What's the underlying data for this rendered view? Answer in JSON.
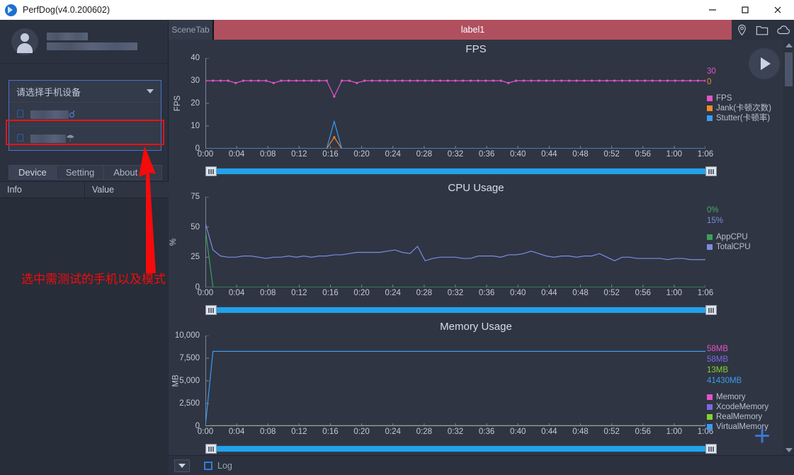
{
  "titlebar": {
    "app_title": "PerfDog(v4.0.200602)",
    "minimize_label": "—",
    "maximize_label": "□",
    "close_label": "✕"
  },
  "sidebar": {
    "device_select": {
      "placeholder": "请选择手机设备",
      "options": [
        {
          "platform_icon": "apple-icon",
          "name_masked": "",
          "connection": "usb-icon"
        },
        {
          "platform_icon": "apple-icon",
          "name_masked": "",
          "connection": "wifi-icon"
        }
      ]
    },
    "tabs": [
      {
        "label": "Device",
        "active": true
      },
      {
        "label": "Setting",
        "active": false
      },
      {
        "label": "About",
        "active": false
      }
    ],
    "table": {
      "columns": [
        "Info",
        "Value"
      ],
      "rows": []
    },
    "annotation": "选中需测试的手机以及模式",
    "annotation_color": "#f50b0b",
    "highlight_box_color": "#ee1111"
  },
  "scenebar": {
    "scene_tab_label": "SceneTab",
    "label_text": "label1",
    "label_color": "#b0505f",
    "icons": [
      "location-pin-icon",
      "folder-icon",
      "cloud-icon"
    ]
  },
  "statusbar": {
    "log_label": "Log",
    "log_checked": false
  },
  "controls": {
    "play_label": "play-icon",
    "add_label": "+"
  },
  "chart_data": [
    {
      "type": "line",
      "title": "FPS",
      "xlabel": "",
      "ylabel": "FPS",
      "ylim": [
        0,
        40
      ],
      "yticks": [
        0,
        10,
        20,
        30,
        40
      ],
      "xticks": [
        "0:00",
        "0:04",
        "0:08",
        "0:12",
        "0:16",
        "0:20",
        "0:24",
        "0:28",
        "0:32",
        "0:36",
        "0:40",
        "0:44",
        "0:48",
        "0:52",
        "0:56",
        "1:00",
        "1:06"
      ],
      "xlim": [
        0,
        66
      ],
      "grid": false,
      "legend_position": "right",
      "current_values": [
        {
          "text": "30",
          "color": "#e254c8"
        },
        {
          "text": "0",
          "color": "#f08a2a"
        }
      ],
      "series": [
        {
          "name": "FPS",
          "color": "#e254c8",
          "markers": true,
          "values": [
            30,
            30,
            30,
            30,
            29,
            30,
            30,
            30,
            30,
            29,
            30,
            30,
            30,
            30,
            30,
            30,
            30,
            23,
            30,
            30,
            29,
            30,
            30,
            30,
            30,
            30,
            30,
            30,
            30,
            30,
            30,
            30,
            30,
            30,
            30,
            30,
            30,
            30,
            30,
            30,
            29,
            30,
            30,
            30,
            30,
            30,
            30,
            30,
            30,
            30,
            30,
            30,
            30,
            30,
            30,
            30,
            30,
            30,
            30,
            30,
            30,
            30,
            30,
            30,
            30,
            30,
            30
          ]
        },
        {
          "name": "Jank(卡顿次数)",
          "color": "#f08a2a",
          "markers": true,
          "values": [
            0,
            0,
            0,
            0,
            0,
            0,
            0,
            0,
            0,
            0,
            0,
            0,
            0,
            0,
            0,
            0,
            0,
            5,
            0,
            0,
            0,
            0,
            0,
            0,
            0,
            0,
            0,
            0,
            0,
            0,
            0,
            0,
            0,
            0,
            0,
            0,
            0,
            0,
            0,
            0,
            0,
            0,
            0,
            0,
            0,
            0,
            0,
            0,
            0,
            0,
            0,
            0,
            0,
            0,
            0,
            0,
            0,
            0,
            0,
            0,
            0,
            0,
            0,
            0,
            0,
            0,
            0
          ]
        },
        {
          "name": "Stutter(卡顿率)",
          "color": "#3d9bf0",
          "markers": false,
          "values": [
            0,
            0,
            0,
            0,
            0,
            0,
            0,
            0,
            0,
            0,
            0,
            0,
            0,
            0,
            0,
            0,
            0,
            12,
            0,
            0,
            0,
            0,
            0,
            0,
            0,
            0,
            0,
            0,
            0,
            0,
            0,
            0,
            0,
            0,
            0,
            0,
            0,
            0,
            0,
            0,
            0,
            0,
            0,
            0,
            0,
            0,
            0,
            0,
            0,
            0,
            0,
            0,
            0,
            0,
            0,
            0,
            0,
            0,
            0,
            0,
            0,
            0,
            0,
            0,
            0,
            0,
            0
          ]
        }
      ]
    },
    {
      "type": "line",
      "title": "CPU Usage",
      "xlabel": "",
      "ylabel": "%",
      "ylim": [
        0,
        75
      ],
      "yticks": [
        0,
        25,
        50,
        75
      ],
      "xticks": [
        "0:00",
        "0:04",
        "0:08",
        "0:12",
        "0:16",
        "0:20",
        "0:24",
        "0:28",
        "0:32",
        "0:36",
        "0:40",
        "0:44",
        "0:48",
        "0:52",
        "0:56",
        "1:00",
        "1:06"
      ],
      "xlim": [
        0,
        66
      ],
      "grid": false,
      "legend_position": "right",
      "current_values": [
        {
          "text": "0%",
          "color": "#4aa86a"
        },
        {
          "text": "15%",
          "color": "#7a8de0"
        }
      ],
      "series": [
        {
          "name": "AppCPU",
          "color": "#3f9e5d",
          "markers": false,
          "values": [
            48,
            0,
            0,
            0,
            0,
            0,
            0,
            0,
            0,
            0,
            0,
            0,
            0,
            0,
            0,
            0,
            0,
            0,
            0,
            0,
            0,
            0,
            0,
            0,
            0,
            0,
            0,
            0,
            0,
            0,
            0,
            0,
            0,
            0,
            0,
            0,
            0,
            0,
            0,
            0,
            0,
            0,
            0,
            0,
            0,
            0,
            0,
            0,
            0,
            0,
            0,
            0,
            0,
            0,
            0,
            0,
            0,
            0,
            0,
            0,
            0,
            0,
            0,
            0,
            0,
            0,
            0
          ]
        },
        {
          "name": "TotalCPU",
          "color": "#7a8de0",
          "markers": false,
          "values": [
            53,
            31,
            26,
            25,
            25,
            26,
            26,
            25,
            24,
            25,
            25,
            26,
            25,
            26,
            25,
            26,
            26,
            27,
            27,
            28,
            29,
            29,
            29,
            29,
            30,
            31,
            29,
            28,
            34,
            22,
            24,
            25,
            25,
            25,
            24,
            24,
            26,
            26,
            26,
            25,
            27,
            27,
            28,
            30,
            28,
            26,
            25,
            26,
            26,
            25,
            26,
            26,
            28,
            25,
            22,
            25,
            25,
            24,
            24,
            24,
            24,
            23,
            24,
            24,
            23,
            23,
            23
          ]
        }
      ]
    },
    {
      "type": "line",
      "title": "Memory Usage",
      "xlabel": "",
      "ylabel": "MB",
      "ylim": [
        0,
        10000
      ],
      "yticks": [
        0,
        2500,
        5000,
        7500,
        10000
      ],
      "ytick_labels": [
        "0",
        "2,500",
        "5,000",
        "7,500",
        "10,000"
      ],
      "xticks": [
        "0:00",
        "0:04",
        "0:08",
        "0:12",
        "0:16",
        "0:20",
        "0:24",
        "0:28",
        "0:32",
        "0:36",
        "0:40",
        "0:44",
        "0:48",
        "0:52",
        "0:56",
        "1:00",
        "1:06"
      ],
      "xlim": [
        0,
        66
      ],
      "grid": false,
      "legend_position": "right",
      "current_values": [
        {
          "text": "58MB",
          "color": "#e254c8"
        },
        {
          "text": "58MB",
          "color": "#7a6ae0"
        },
        {
          "text": "13MB",
          "color": "#82d42a"
        },
        {
          "text": "41430MB",
          "color": "#3d9bf0"
        }
      ],
      "series": [
        {
          "name": "Memory",
          "color": "#e254c8",
          "markers": false,
          "values": [
            20,
            58,
            58,
            58,
            58,
            58,
            58,
            58,
            58,
            58,
            58,
            58,
            58,
            58,
            58,
            58,
            58,
            58,
            58,
            58,
            58,
            58,
            58,
            58,
            58,
            58,
            58,
            58,
            58,
            58,
            58,
            58,
            58,
            58,
            58,
            58,
            58,
            58,
            58,
            58,
            58,
            58,
            58,
            58,
            58,
            58,
            58,
            58,
            58,
            58,
            58,
            58,
            58,
            58,
            58,
            58,
            58,
            58,
            58,
            58,
            58,
            58,
            58,
            58,
            58,
            58,
            58
          ]
        },
        {
          "name": "XcodeMemory",
          "color": "#7a6ae0",
          "markers": false,
          "values": [
            20,
            58,
            58,
            58,
            58,
            58,
            58,
            58,
            58,
            58,
            58,
            58,
            58,
            58,
            58,
            58,
            58,
            58,
            58,
            58,
            58,
            58,
            58,
            58,
            58,
            58,
            58,
            58,
            58,
            58,
            58,
            58,
            58,
            58,
            58,
            58,
            58,
            58,
            58,
            58,
            58,
            58,
            58,
            58,
            58,
            58,
            58,
            58,
            58,
            58,
            58,
            58,
            58,
            58,
            58,
            58,
            58,
            58,
            58,
            58,
            58,
            58,
            58,
            58,
            58,
            58,
            58
          ]
        },
        {
          "name": "RealMemory",
          "color": "#82d42a",
          "markers": false,
          "values": [
            10,
            13,
            13,
            13,
            13,
            13,
            13,
            13,
            13,
            13,
            13,
            13,
            13,
            13,
            13,
            13,
            13,
            13,
            13,
            13,
            13,
            13,
            13,
            13,
            13,
            13,
            13,
            13,
            13,
            13,
            13,
            13,
            13,
            13,
            13,
            13,
            13,
            13,
            13,
            13,
            13,
            13,
            13,
            13,
            13,
            13,
            13,
            13,
            13,
            13,
            13,
            13,
            13,
            13,
            13,
            13,
            13,
            13,
            13,
            13,
            13,
            13,
            13,
            13,
            13,
            13,
            13
          ]
        },
        {
          "name": "VirtualMemory",
          "color": "#3d9bf0",
          "markers": false,
          "values": [
            60,
            8250,
            8250,
            8250,
            8250,
            8250,
            8250,
            8250,
            8250,
            8250,
            8250,
            8250,
            8250,
            8250,
            8250,
            8250,
            8250,
            8250,
            8250,
            8250,
            8250,
            8250,
            8250,
            8250,
            8250,
            8250,
            8250,
            8250,
            8250,
            8250,
            8250,
            8250,
            8250,
            8250,
            8250,
            8250,
            8250,
            8250,
            8250,
            8250,
            8250,
            8250,
            8250,
            8250,
            8250,
            8250,
            8250,
            8250,
            8250,
            8250,
            8250,
            8250,
            8250,
            8250,
            8250,
            8250,
            8250,
            8250,
            8250,
            8250,
            8250,
            8250,
            8250,
            8250,
            8250,
            8250,
            8250
          ]
        }
      ]
    }
  ]
}
